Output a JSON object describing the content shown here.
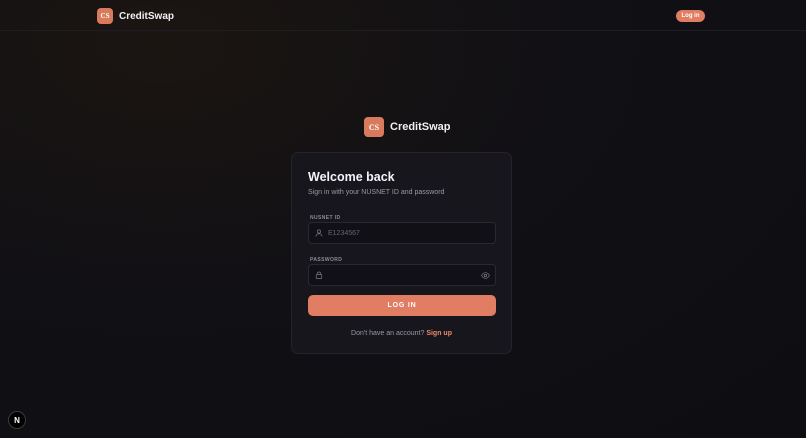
{
  "topbar": {
    "logo_text": "CS",
    "brand": "CreditSwap",
    "login_button": "Log in"
  },
  "center_brand": {
    "logo_text": "CS",
    "brand": "CreditSwap"
  },
  "card": {
    "title": "Welcome back",
    "subtitle": "Sign in with your NUSNET ID and password",
    "nusnet_label": "NUSNET ID",
    "nusnet_placeholder": "E1234567",
    "nusnet_value": "",
    "password_label": "PASSWORD",
    "password_placeholder": "",
    "password_value": "",
    "submit_label": "LOG IN",
    "signup_prompt": "Don't have an account?",
    "signup_link": "Sign up"
  },
  "dev_badge": "N",
  "colors": {
    "accent": "#e07d63",
    "logo": "#d97a5c",
    "background": "#0e0e12",
    "card": "#17161d"
  },
  "icons": {
    "user_field": "user-icon",
    "password_field": "lock-icon",
    "password_toggle": "eye-icon"
  }
}
